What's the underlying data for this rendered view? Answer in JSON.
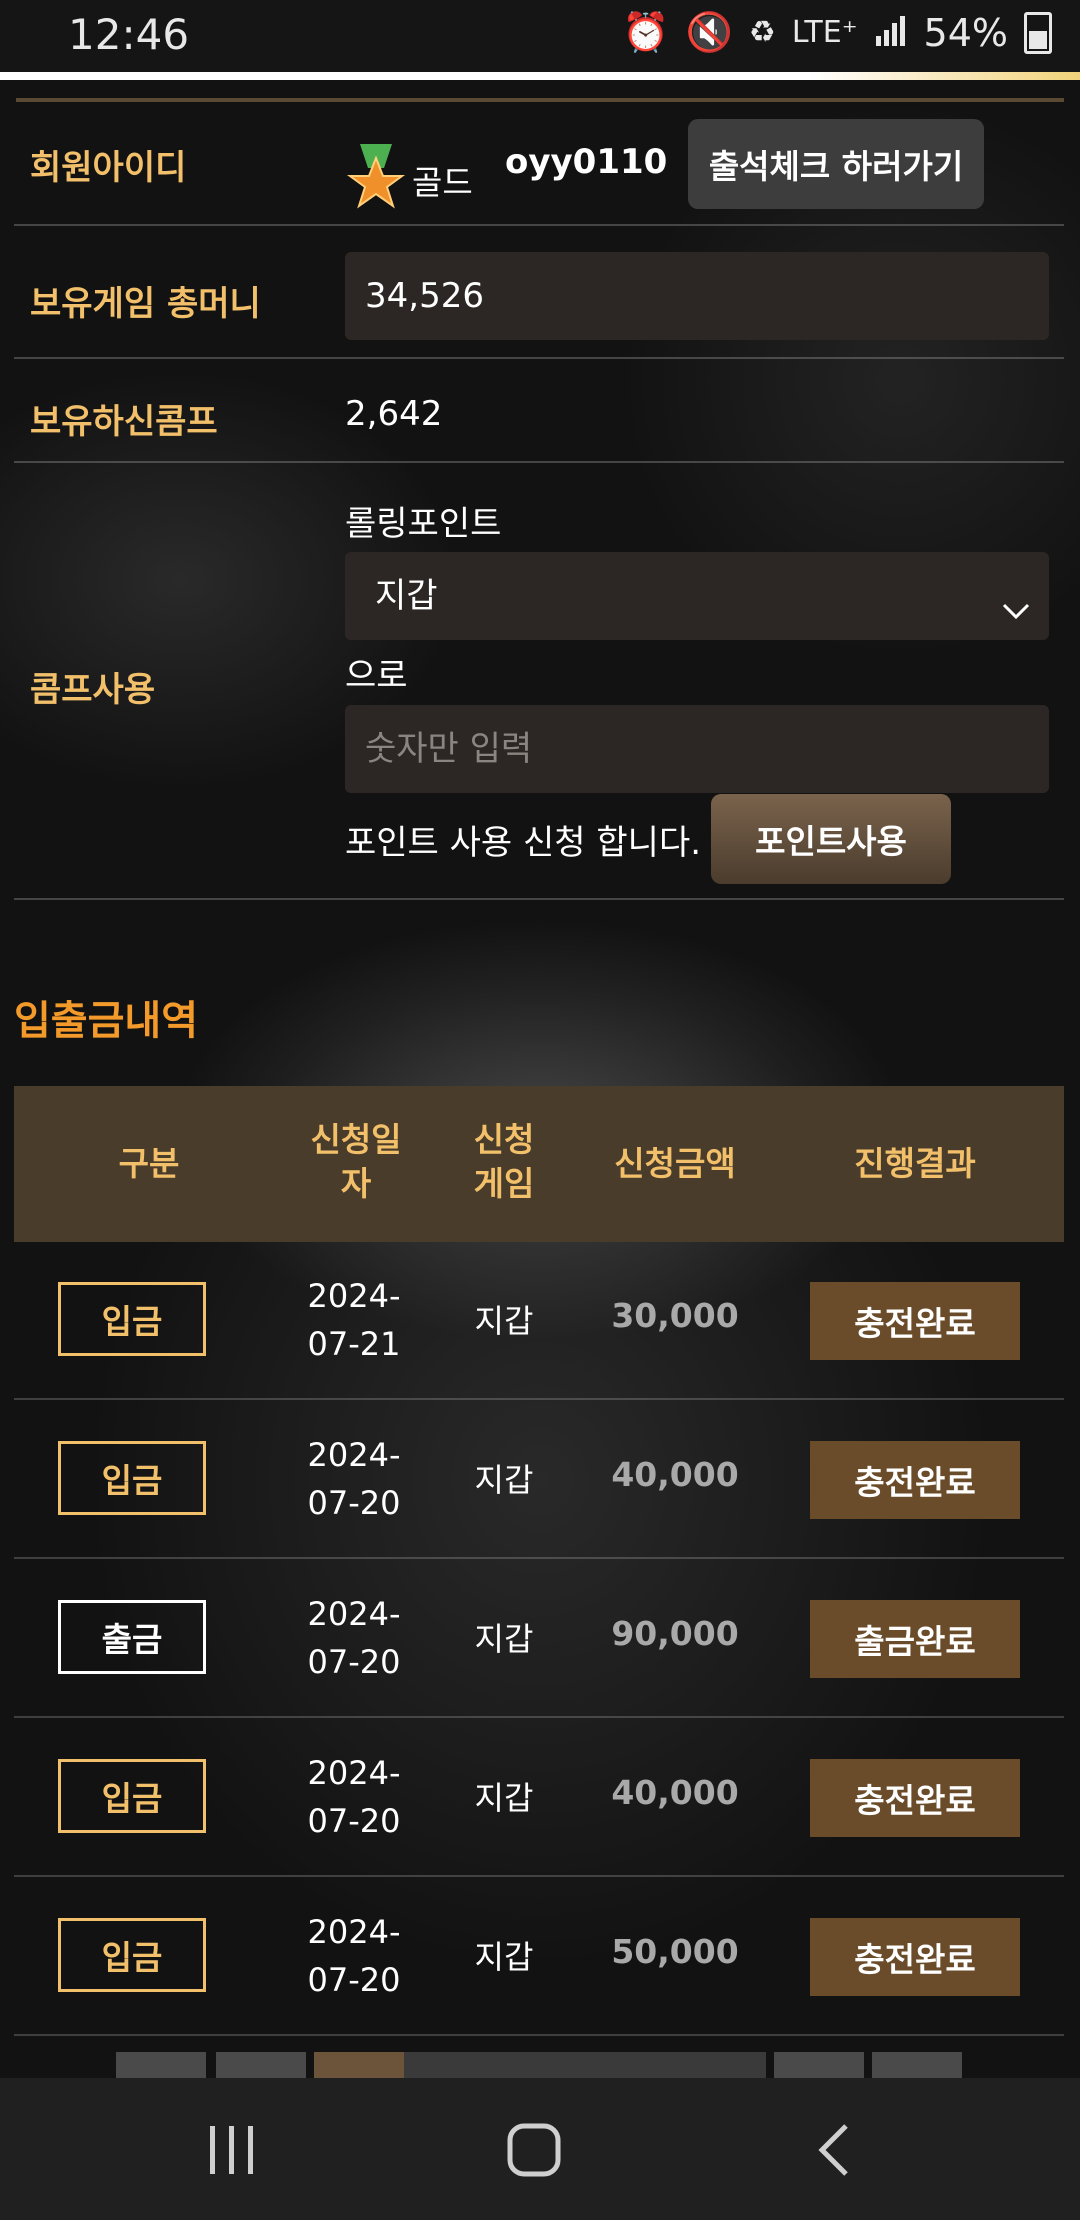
{
  "status_bar": {
    "time": "12:46",
    "network": "LTE⁺",
    "battery": "54%"
  },
  "account": {
    "id_label": "회원아이디",
    "grade": "골드",
    "user_id": "oyy0110",
    "attendance_button": "출석체크 하러가기",
    "money_label": "보유게임 총머니",
    "money_value": "34,526",
    "comp_label": "보유하신콤프",
    "comp_value": "2,642",
    "comp_use_label": "콤프사용",
    "rolling_label": "롤링포인트",
    "wallet_select": "지갑",
    "to_label": "으로",
    "amount_placeholder": "숫자만 입력",
    "apply_text": "포인트 사용 신청 합니다.",
    "point_button": "포인트사용"
  },
  "history": {
    "title": "입출금내역",
    "headers": {
      "type": "구분",
      "date_l1": "신청일",
      "date_l2": "자",
      "game_l1": "신청",
      "game_l2": "게임",
      "amount": "신청금액",
      "result": "진행결과"
    },
    "rows": [
      {
        "type": "입금",
        "date_l1": "2024-",
        "date_l2": "07-21",
        "game": "지갑",
        "amount": "30,000",
        "result": "충전완료"
      },
      {
        "type": "입금",
        "date_l1": "2024-",
        "date_l2": "07-20",
        "game": "지갑",
        "amount": "40,000",
        "result": "충전완료"
      },
      {
        "type": "출금",
        "date_l1": "2024-",
        "date_l2": "07-20",
        "game": "지갑",
        "amount": "90,000",
        "result": "출금완료"
      },
      {
        "type": "입금",
        "date_l1": "2024-",
        "date_l2": "07-20",
        "game": "지갑",
        "amount": "40,000",
        "result": "충전완료"
      },
      {
        "type": "입금",
        "date_l1": "2024-",
        "date_l2": "07-20",
        "game": "지갑",
        "amount": "50,000",
        "result": "충전완료"
      }
    ]
  },
  "colors": {
    "gold": "#f2c06a",
    "orange": "#f39a2a",
    "header_bg": "#4a3c2a",
    "result_bg": "#6b4c2a"
  },
  "icons": [
    "alarm-icon",
    "mute-icon",
    "battery-saver-icon",
    "signal-icon",
    "battery-icon",
    "medal-star-icon",
    "chevron-down-icon",
    "recents-icon",
    "home-icon",
    "back-icon"
  ]
}
